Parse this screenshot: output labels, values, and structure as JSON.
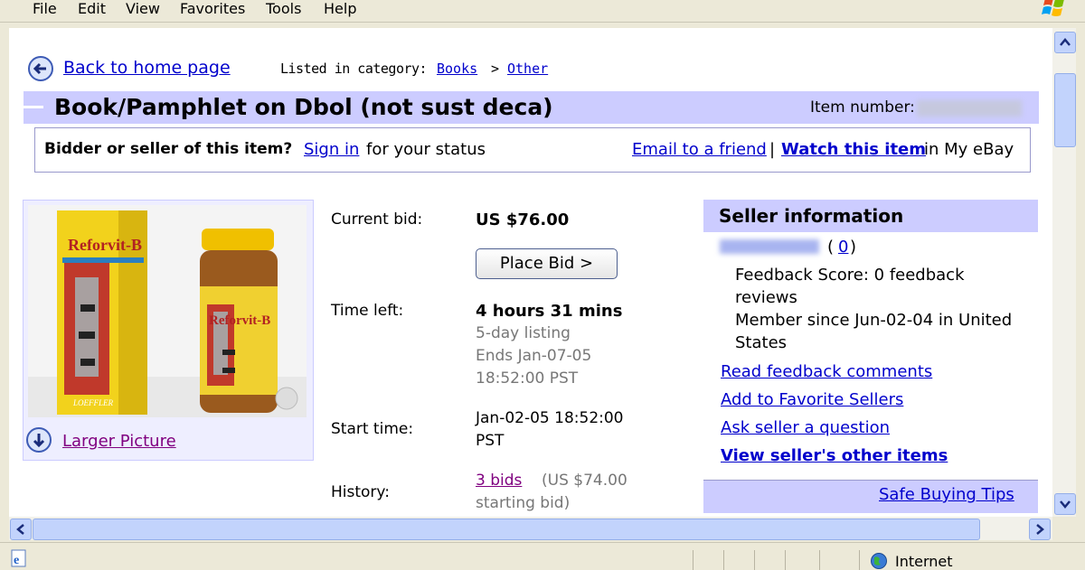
{
  "menu": [
    "File",
    "Edit",
    "View",
    "Favorites",
    "Tools",
    "Help"
  ],
  "nav": {
    "back_link": "Back to home page",
    "listed_in": "Listed in category:",
    "cat1": "Books",
    "sep": ">",
    "cat2": "Other"
  },
  "item": {
    "title": "Book/Pamphlet on Dbol (not sust deca)",
    "number_label": "Item number:"
  },
  "status": {
    "bidder_q": "Bidder or seller of this item?",
    "sign_in": "Sign in",
    "for_status": "for your status",
    "email_friend": "Email to a friend",
    "pipe": "|",
    "watch": "Watch this item",
    "in_myebay": "in My eBay"
  },
  "picture": {
    "larger": "Larger Picture",
    "label_text": "Reforvit-B",
    "brand": "LOEFFLER"
  },
  "bid": {
    "current_label": "Current bid:",
    "current_value": "US $76.00",
    "place_bid": "Place Bid >",
    "time_left_label": "Time left:",
    "time_left_value": "4 hours 31 mins",
    "listing_days": "5-day listing",
    "ends": "Ends Jan-07-05",
    "ends_time": "18:52:00 PST",
    "start_label": "Start time:",
    "start_value_1": "Jan-02-05 18:52:00",
    "start_value_2": "PST",
    "history_label": "History:",
    "bids": "3 bids",
    "starting_1": "(US $74.00",
    "starting_2": "starting bid)"
  },
  "seller": {
    "heading": "Seller information",
    "feedback_open": "(",
    "feedback_count": "0",
    "feedback_close": ")",
    "score_1": "Feedback Score: 0 feedback",
    "score_2": "reviews",
    "member_1": "Member since Jun-02-04 in United",
    "member_2": "States",
    "read_feedback": "Read feedback comments",
    "add_favorite": "Add to Favorite Sellers",
    "ask_question": "Ask seller a question",
    "other_items": "View seller's other items",
    "safe_tips": "Safe Buying Tips"
  },
  "statusbar": {
    "zone": "Internet"
  }
}
